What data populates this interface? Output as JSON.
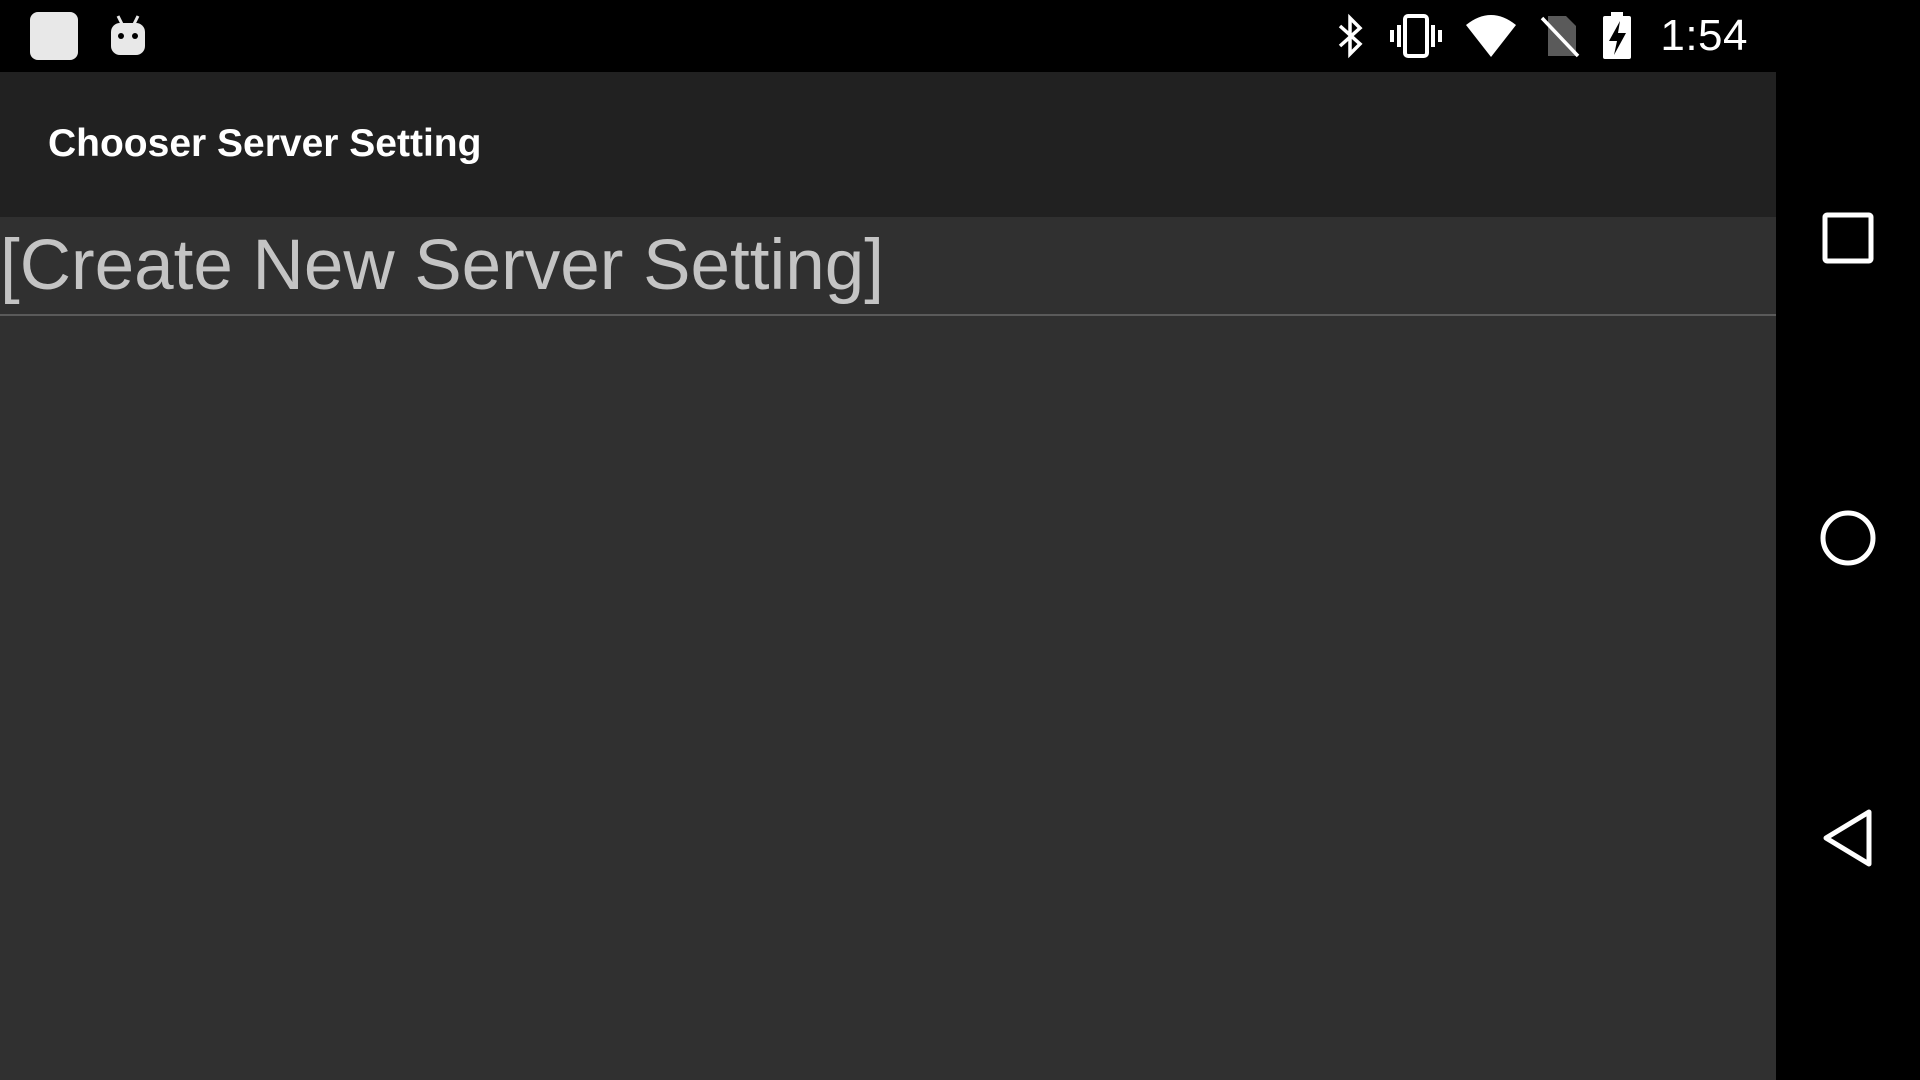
{
  "status_bar": {
    "time": "1:54",
    "icons": [
      "notification-square-icon",
      "android-debug-icon",
      "bluetooth-icon",
      "vibrate-icon",
      "wifi-icon",
      "no-sim-icon",
      "battery-charging-icon"
    ]
  },
  "action_bar": {
    "title": "Chooser Server Setting"
  },
  "list": {
    "items": [
      {
        "label": "[Create New Server Setting]"
      }
    ]
  },
  "nav_bar": {
    "buttons": [
      "recents-icon",
      "home-icon",
      "back-icon"
    ]
  },
  "colors": {
    "status_bar_bg": "#000000",
    "action_bar_bg": "#212121",
    "content_bg": "#303030",
    "title_text": "#ffffff",
    "list_text": "#c4c4c4"
  }
}
